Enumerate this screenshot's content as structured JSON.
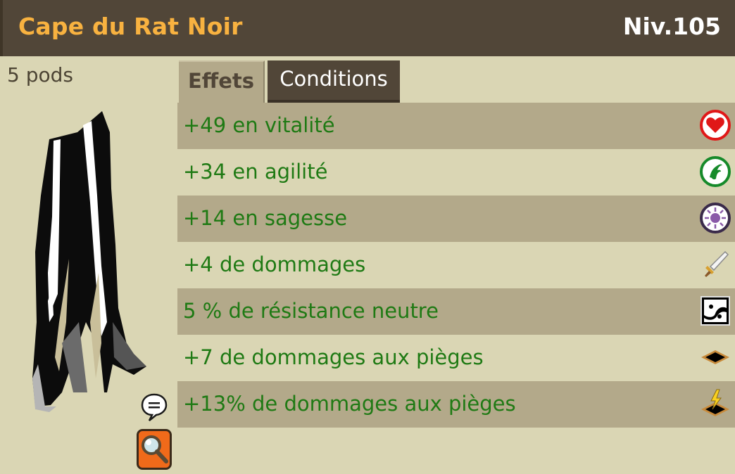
{
  "item": {
    "name": "Cape du Rat Noir",
    "level": "Niv.105",
    "weight": "5 pods"
  },
  "tabs": [
    {
      "label": "Effets",
      "active": true
    },
    {
      "label": "Conditions",
      "active": false
    }
  ],
  "effects": [
    {
      "text": "+49 en vitalité",
      "icon": "vitality-heart-icon"
    },
    {
      "text": "+34 en agilité",
      "icon": "agility-icon"
    },
    {
      "text": "+14 en sagesse",
      "icon": "wisdom-icon"
    },
    {
      "text": "+4 de dommages",
      "icon": "sword-damage-icon"
    },
    {
      "text": "5 % de résistance neutre",
      "icon": "neutral-resistance-icon"
    },
    {
      "text": "+7 de dommages aux pièges",
      "icon": "trap-icon"
    },
    {
      "text": "+13% de dommages aux pièges",
      "icon": "trap-lightning-icon"
    }
  ],
  "colors": {
    "header_bg": "#514638",
    "title": "#f8b240",
    "effect_text": "#1f7a14",
    "row_dark": "#b3a98a",
    "row_light": "#dad6b4"
  }
}
